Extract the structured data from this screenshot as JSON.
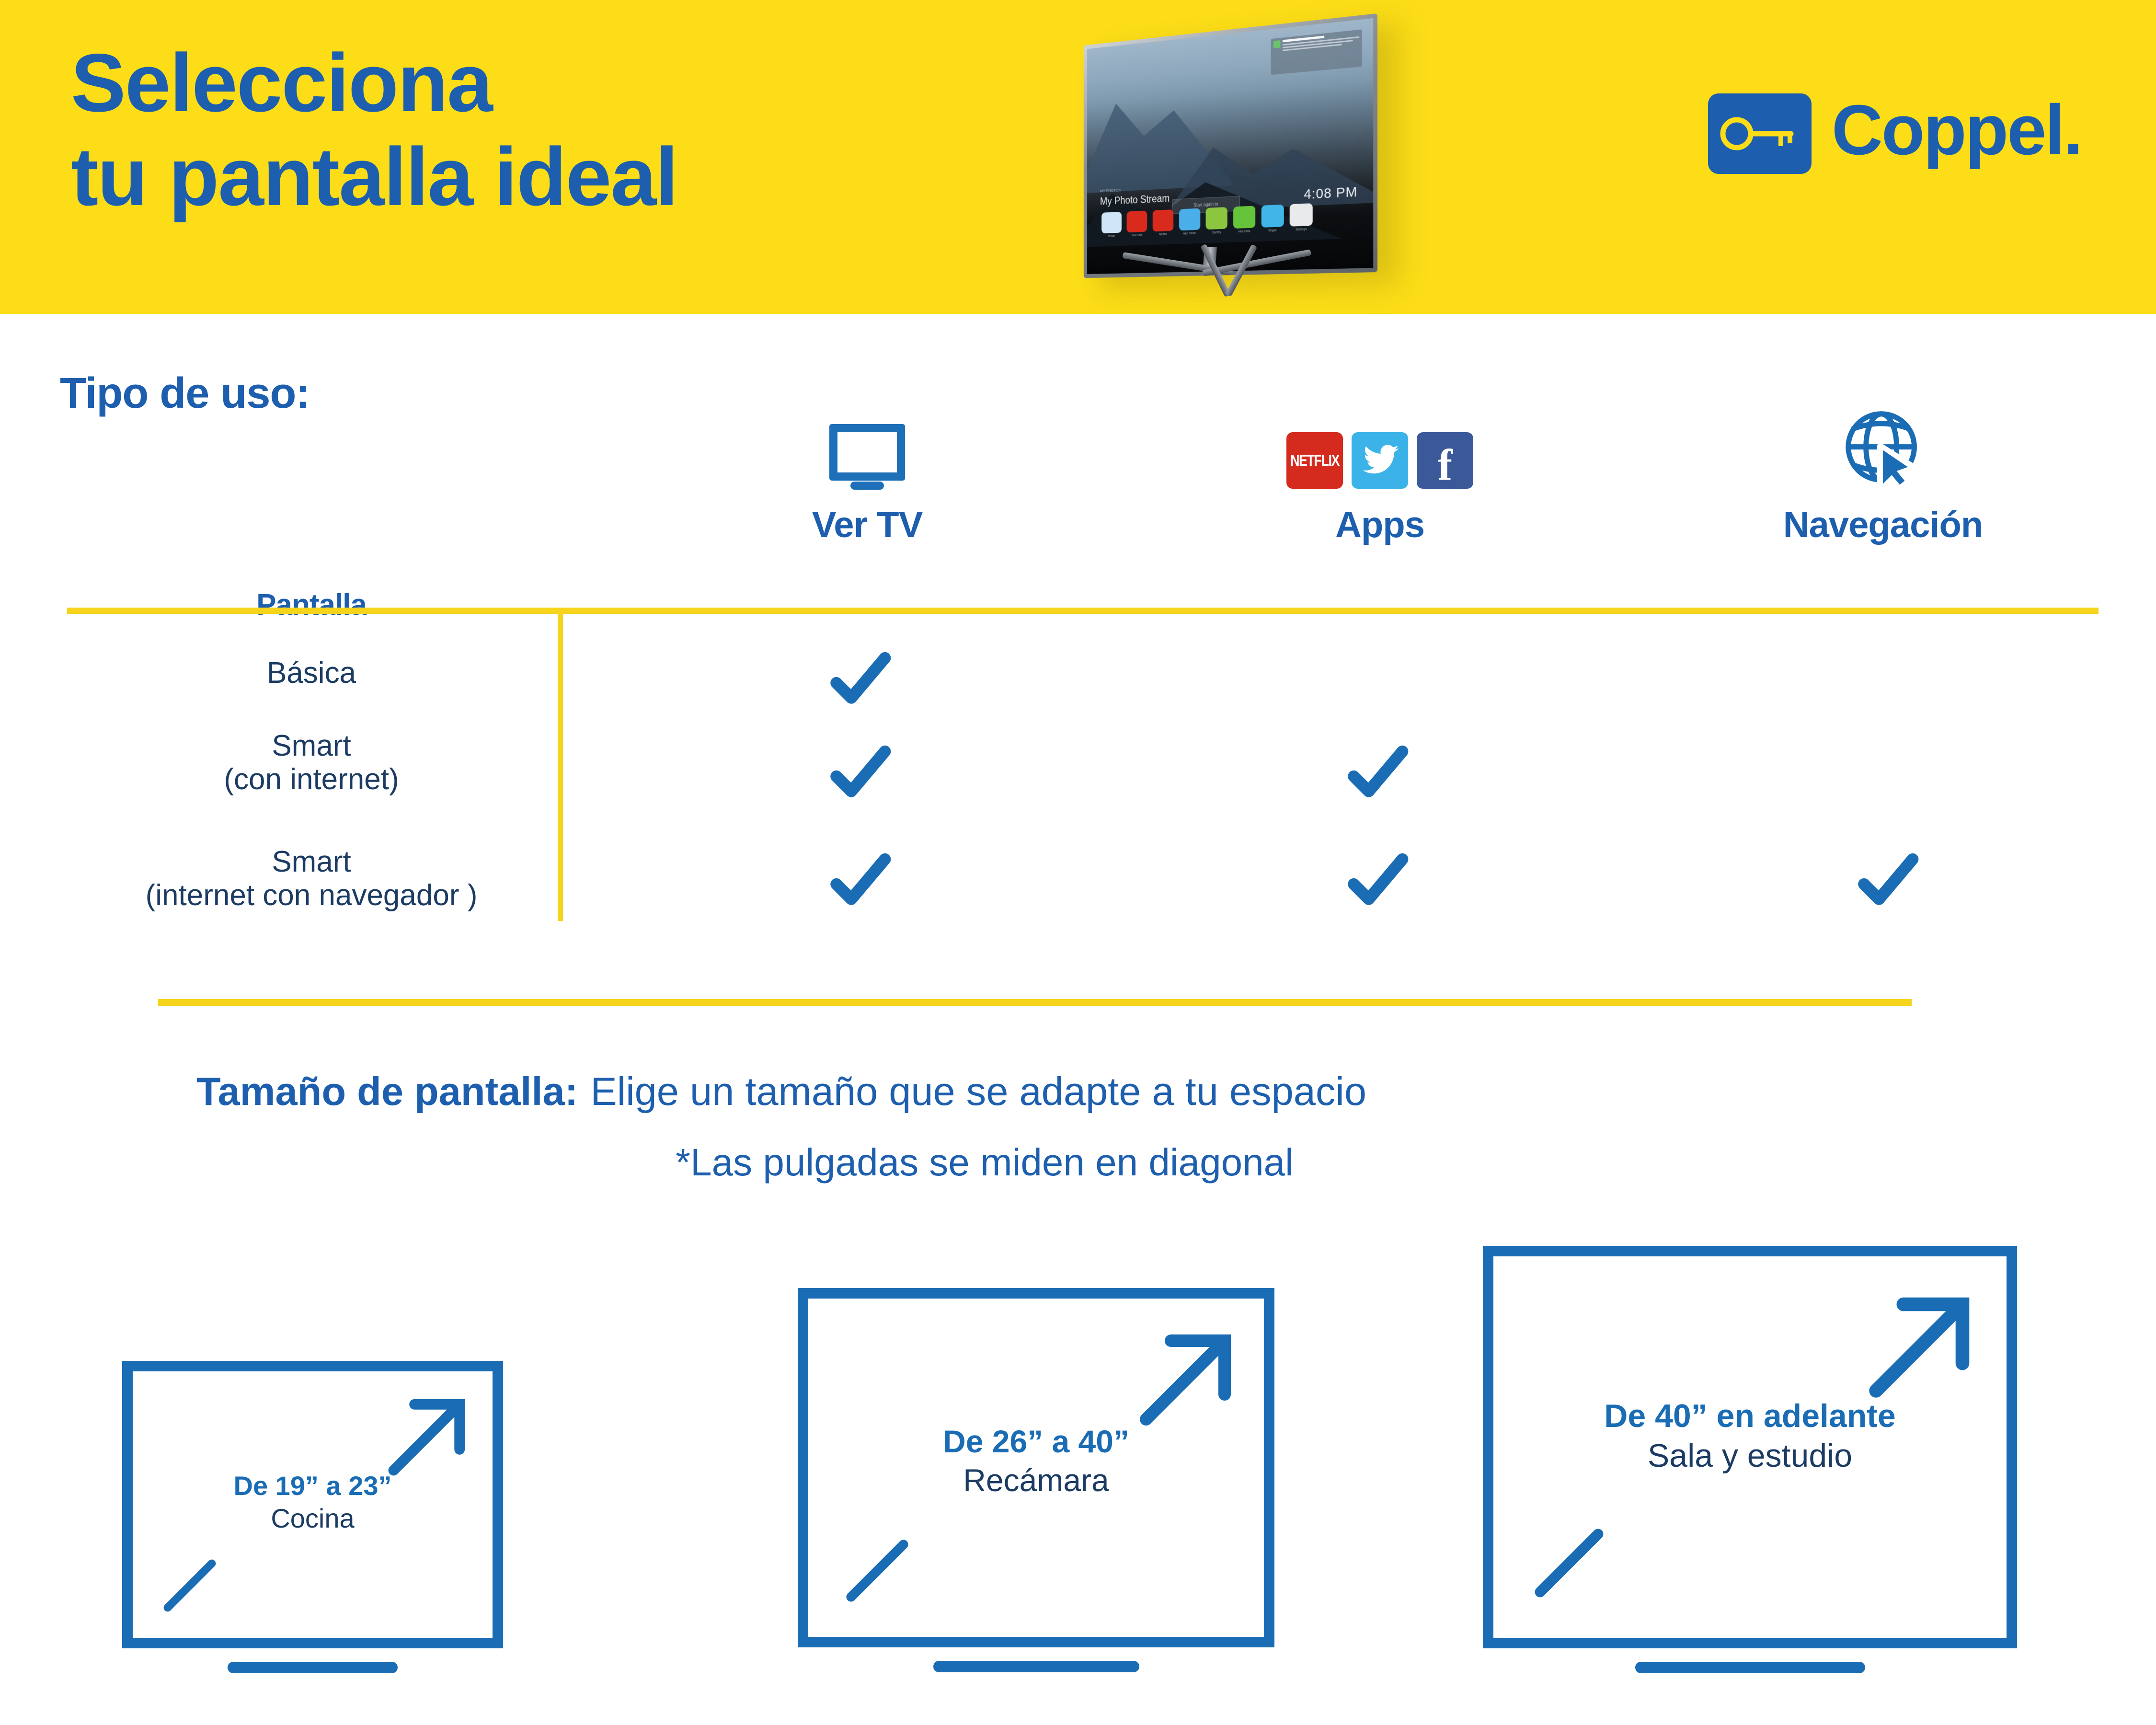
{
  "colors": {
    "brand_yellow": "#FCDD17",
    "rule_yellow": "#F5D41B",
    "brand_blue": "#1D5FAE",
    "icon_blue": "#1A6DB4",
    "text_navy": "#1b3b63",
    "netflix_red": "#D52B1E",
    "twitter_blue": "#3BB3E8",
    "facebook_blue": "#3B5998"
  },
  "header": {
    "headline": "Selecciona\ntu pantalla ideal",
    "logo": {
      "wordmark": "Coppel.",
      "mark_icon": "key-icon"
    },
    "tv_photo": {
      "notification_icon": "message-icon",
      "source_label": "MY PHOTOS",
      "title": "My Photo Stream",
      "pill_label": "Start again in",
      "clock": "4:08 PM",
      "apps": [
        {
          "name": "Photo",
          "color": "#cfe6f7"
        },
        {
          "name": "YouTube",
          "color": "#d92b1d"
        },
        {
          "name": "Netflix",
          "color": "#d92b1d"
        },
        {
          "name": "App Store",
          "color": "#4aaee8"
        },
        {
          "name": "Spotify",
          "color": "#8cc63f"
        },
        {
          "name": "HuluPlus",
          "color": "#66c43a"
        },
        {
          "name": "Skype",
          "color": "#3fb5e8"
        },
        {
          "name": "Settings",
          "color": "#e9eaec"
        }
      ]
    }
  },
  "usage_section": {
    "label": "Tipo de uso:",
    "columns": [
      {
        "key": "pantalla",
        "label": "Pantalla",
        "icon": "none"
      },
      {
        "key": "ver_tv",
        "label": "Ver TV",
        "icon": "tv-outline-icon"
      },
      {
        "key": "apps",
        "label": "Apps",
        "icon": "app-badges-icon"
      },
      {
        "key": "navegacion",
        "label": "Navegación",
        "icon": "globe-cursor-icon"
      }
    ],
    "app_badges": [
      {
        "name": "netflix-icon",
        "text": "NETFLIX"
      },
      {
        "name": "twitter-icon",
        "text": ""
      },
      {
        "name": "facebook-icon",
        "text": "f"
      }
    ],
    "rows": [
      {
        "label": "Básica",
        "ver_tv": true,
        "apps": false,
        "navegacion": false
      },
      {
        "label": "Smart\n(con internet)",
        "ver_tv": true,
        "apps": true,
        "navegacion": false
      },
      {
        "label": "Smart\n(internet con navegador )",
        "ver_tv": true,
        "apps": true,
        "navegacion": true
      }
    ]
  },
  "size_section": {
    "heading_bold": "Tamaño de pantalla:",
    "heading_normal": "Elige un tamaño que se adapte a tu espacio",
    "note": "*Las pulgadas se miden en diagonal",
    "boxes": [
      {
        "size": "De 19” a 23”",
        "room": "Cocina"
      },
      {
        "size": "De 26” a 40”",
        "room": "Recámara"
      },
      {
        "size": "De 40” en adelante",
        "room": "Sala y estudio"
      }
    ]
  },
  "chart_data": {
    "type": "table",
    "title": "Tipo de uso",
    "columns": [
      "Pantalla",
      "Ver TV",
      "Apps",
      "Navegación"
    ],
    "rows": [
      [
        "Básica",
        "✔",
        "",
        ""
      ],
      [
        "Smart (con internet)",
        "✔",
        "✔",
        ""
      ],
      [
        "Smart (internet con navegador )",
        "✔",
        "✔",
        "✔"
      ]
    ]
  }
}
